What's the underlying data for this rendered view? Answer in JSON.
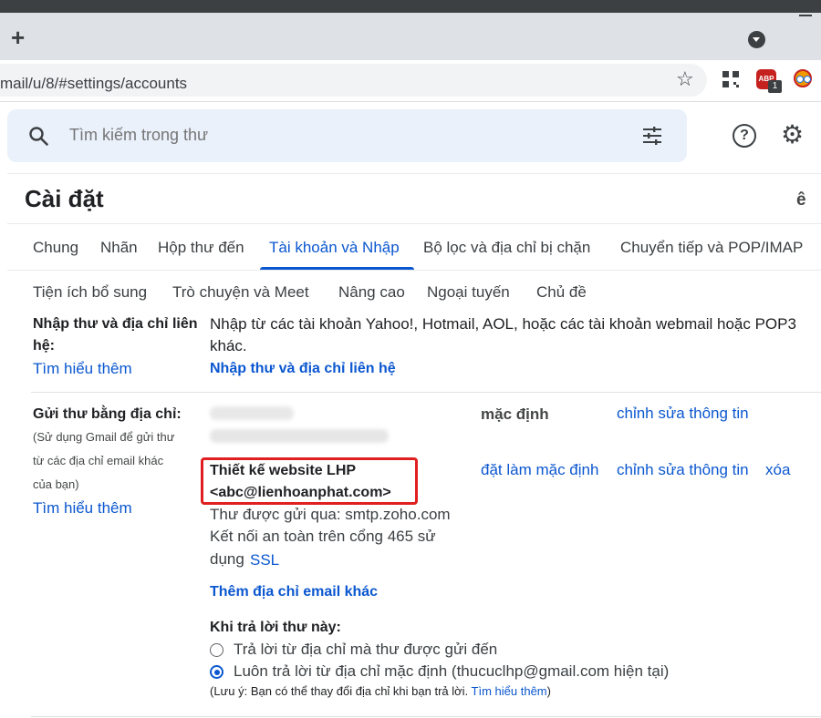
{
  "browser": {
    "new_tab": "+",
    "url": "mail/u/8/#settings/accounts",
    "abp_label": "ABP",
    "abp_badge": "1"
  },
  "header": {
    "search_placeholder": "Tìm kiếm trong thư",
    "help_glyph": "?",
    "page_title": "Cài đặt",
    "lang_glyph": "ê"
  },
  "tabs": {
    "row1": [
      "Chung",
      "Nhãn",
      "Hộp thư đến",
      "Tài khoản và Nhập",
      "Bộ lọc và địa chỉ bị chặn",
      "Chuyển tiếp và POP/IMAP"
    ],
    "row2": [
      "Tiện ích bổ sung",
      "Trò chuyện và Meet",
      "Nâng cao",
      "Ngoại tuyến",
      "Chủ đề"
    ],
    "active": "Tài khoản và Nhập"
  },
  "import_section": {
    "label_line1": "Nhập thư và địa chỉ liên",
    "label_line2": "hệ:",
    "learn_more": "Tìm hiểu thêm",
    "desc_line1": "Nhập từ các tài khoản Yahoo!, Hotmail, AOL, hoặc các tài khoản webmail hoặc POP3",
    "desc_line2": "khác.",
    "action_link": "Nhập thư và địa chỉ liên hệ"
  },
  "send_as_section": {
    "label": "Gửi thư bằng địa chỉ:",
    "hint_line1": "(Sử dụng Gmail để gửi thư",
    "hint_line2": "từ các địa chỉ email khác",
    "hint_line3": "của bạn)",
    "learn_more": "Tìm hiểu thêm",
    "default_label": "mặc định",
    "edit_info_1": "chỉnh sửa thông tin",
    "set_default": "đặt làm mặc định",
    "edit_info_2": "chỉnh sửa thông tin",
    "delete": "xóa",
    "account_name": "Thiết kế website LHP",
    "account_email": "<abc@lienhoanphat.com>",
    "smtp_line": "Thư được gửi qua: smtp.zoho.com",
    "secure_line1": "Kết nối an toàn trên cổng 465 sử",
    "secure_line2_prefix": "dụng",
    "ssl_link": "SSL",
    "add_address": "Thêm địa chỉ email khác",
    "reply_heading": "Khi trả lời thư này:",
    "reply_option_1": "Trả lời từ địa chỉ mà thư được gửi đến",
    "reply_option_2": "Luôn trả lời từ địa chỉ mặc định (thucuclhp@gmail.com hiện tại)",
    "reply_selected": 2,
    "note_prefix": "(Lưu ý: Bạn có thể thay đổi địa chỉ khi bạn trả lời.",
    "note_link": "Tìm hiểu thêm",
    "note_suffix": ")"
  },
  "colors": {
    "accent": "#0b57d0",
    "highlight_box": "#e02020",
    "search_bg": "#eaf1fb"
  }
}
